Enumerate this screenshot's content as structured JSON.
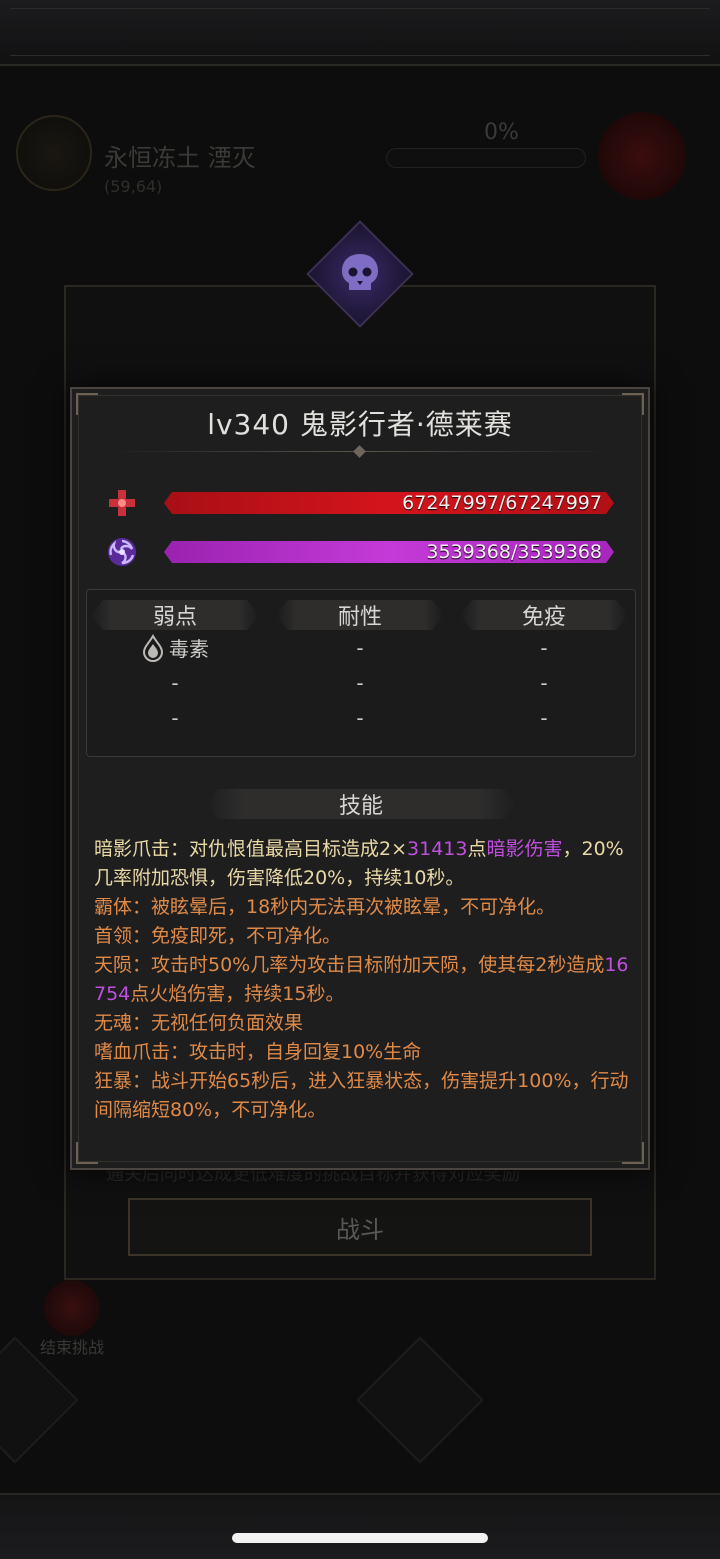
{
  "background": {
    "map_name": "永恒冻土 湮灭",
    "coords": "(59,64)",
    "progress": "0%",
    "fight_button": "战斗",
    "end_challenge": "结束挑战",
    "hint": "通关后同时达成更低难度的挑战目标并获得对应奖励"
  },
  "monster": {
    "title": "lv340  鬼影行者·德莱赛",
    "hp_text": "67247997/67247997",
    "hp_fraction": 1.0,
    "mp_text": "3539368/3539368",
    "mp_fraction": 1.0,
    "hp_color": "#d4141c",
    "mp_color": "#c43ad8"
  },
  "resistances": {
    "headers": [
      "弱点",
      "耐性",
      "免疫"
    ],
    "weakness": [
      {
        "icon": "poison-drop-icon",
        "text": "毒素"
      },
      {
        "icon": "",
        "text": "-"
      },
      {
        "icon": "",
        "text": "-"
      }
    ],
    "resistance": [
      "-",
      "-",
      "-"
    ],
    "immunity": [
      "-",
      "-",
      "-"
    ]
  },
  "skills": {
    "header": "技能",
    "s1": {
      "a": "暗影爪击：对仇恨值最高目标造成2×",
      "b": "31413",
      "c": "点",
      "d": "暗影伤害",
      "e": "，20%几率附加恐惧，伤害降低20%，持续10秒。"
    },
    "s2": "霸体：被眩晕后，18秒内无法再次被眩晕，不可净化。",
    "s3": "首领：免疫即死，不可净化。",
    "s4": {
      "a": "天陨：攻击时50%几率为攻击目标附加天陨，使其每2秒造成",
      "b": "16754",
      "c": "点火焰伤害，持续15秒。"
    },
    "s5": "无魂：无视任何负面效果",
    "s6": "嗜血爪击：攻击时，自身回复10%生命",
    "s7": "狂暴：战斗开始65秒后，进入狂暴状态，伤害提升100%，行动间隔缩短80%，不可净化。"
  }
}
